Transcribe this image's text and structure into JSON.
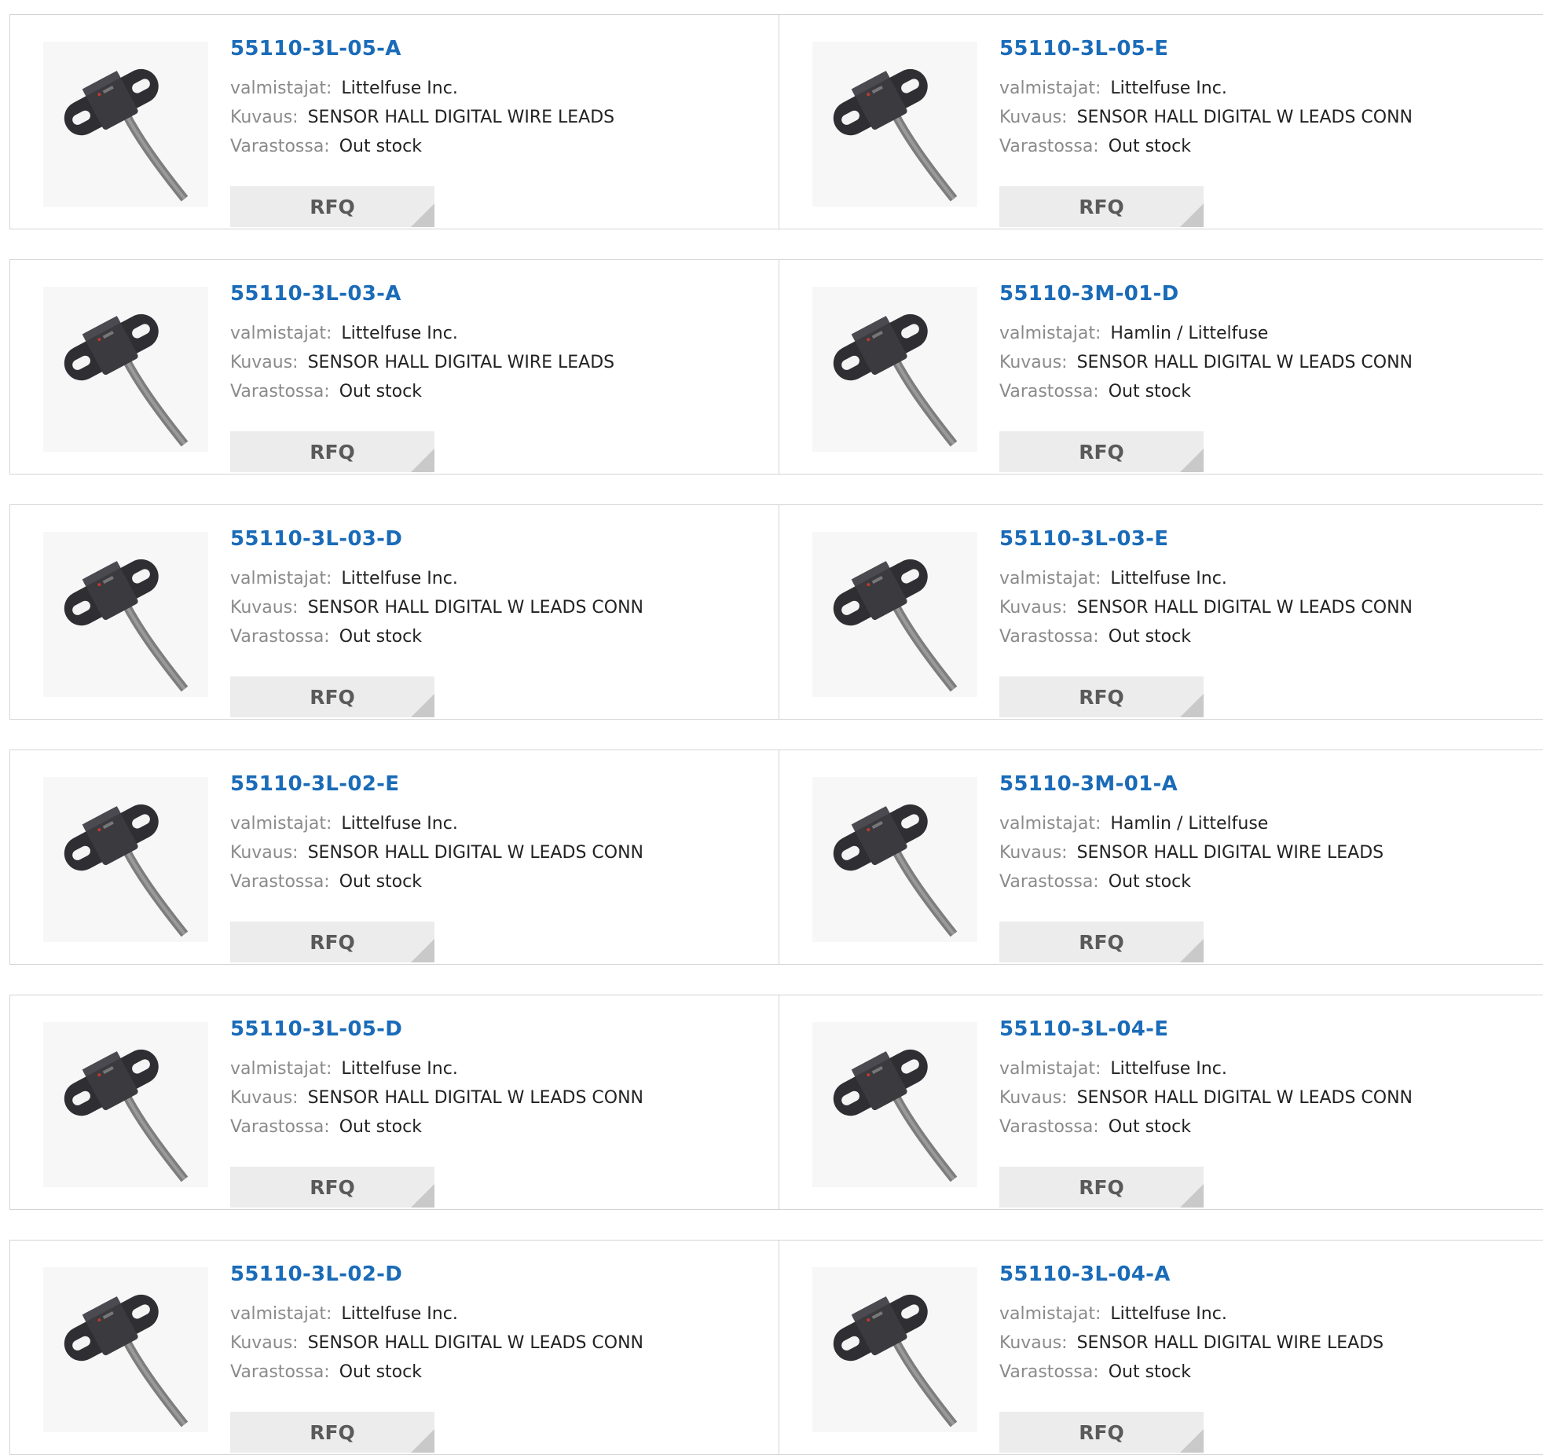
{
  "labels": {
    "manufacturer": "valmistajat:",
    "description": "Kuvaus:",
    "stock": "Varastossa:",
    "rfq": "RFQ"
  },
  "image_icon": "hall-sensor-product-photo",
  "colors": {
    "link": "#1a6bb8",
    "rfq_bg": "#ececec",
    "border": "#d4d4d4"
  },
  "products": [
    {
      "part": "55110-3L-05-A",
      "manufacturer": "Littelfuse Inc.",
      "description": "SENSOR HALL DIGITAL WIRE LEADS",
      "stock": "Out stock"
    },
    {
      "part": "55110-3L-05-E",
      "manufacturer": "Littelfuse Inc.",
      "description": "SENSOR HALL DIGITAL W LEADS CONN",
      "stock": "Out stock"
    },
    {
      "part": "55110-3L-03-A",
      "manufacturer": "Littelfuse Inc.",
      "description": "SENSOR HALL DIGITAL WIRE LEADS",
      "stock": "Out stock"
    },
    {
      "part": "55110-3M-01-D",
      "manufacturer": "Hamlin / Littelfuse",
      "description": "SENSOR HALL DIGITAL W LEADS CONN",
      "stock": "Out stock"
    },
    {
      "part": "55110-3L-03-D",
      "manufacturer": "Littelfuse Inc.",
      "description": "SENSOR HALL DIGITAL W LEADS CONN",
      "stock": "Out stock"
    },
    {
      "part": "55110-3L-03-E",
      "manufacturer": "Littelfuse Inc.",
      "description": "SENSOR HALL DIGITAL W LEADS CONN",
      "stock": "Out stock"
    },
    {
      "part": "55110-3L-02-E",
      "manufacturer": "Littelfuse Inc.",
      "description": "SENSOR HALL DIGITAL W LEADS CONN",
      "stock": "Out stock"
    },
    {
      "part": "55110-3M-01-A",
      "manufacturer": "Hamlin / Littelfuse",
      "description": "SENSOR HALL DIGITAL WIRE LEADS",
      "stock": "Out stock"
    },
    {
      "part": "55110-3L-05-D",
      "manufacturer": "Littelfuse Inc.",
      "description": "SENSOR HALL DIGITAL W LEADS CONN",
      "stock": "Out stock"
    },
    {
      "part": "55110-3L-04-E",
      "manufacturer": "Littelfuse Inc.",
      "description": "SENSOR HALL DIGITAL W LEADS CONN",
      "stock": "Out stock"
    },
    {
      "part": "55110-3L-02-D",
      "manufacturer": "Littelfuse Inc.",
      "description": "SENSOR HALL DIGITAL W LEADS CONN",
      "stock": "Out stock"
    },
    {
      "part": "55110-3L-04-A",
      "manufacturer": "Littelfuse Inc.",
      "description": "SENSOR HALL DIGITAL WIRE LEADS",
      "stock": "Out stock"
    }
  ]
}
